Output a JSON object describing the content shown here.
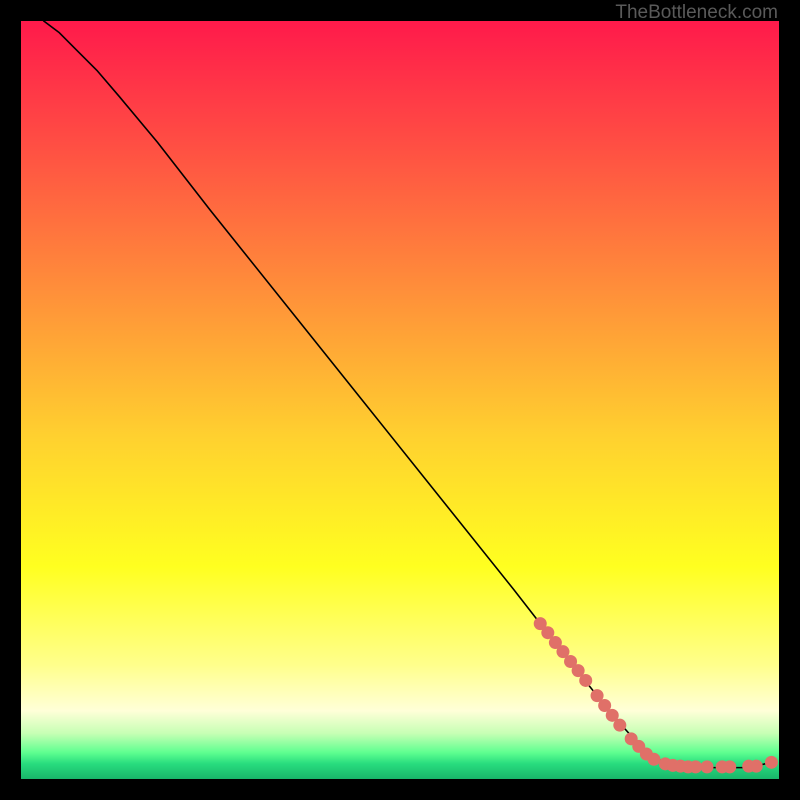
{
  "watermark": "TheBottleneck.com",
  "chart_data": {
    "type": "line",
    "title": "",
    "xlabel": "",
    "ylabel": "",
    "xlim": [
      0,
      100
    ],
    "ylim": [
      0,
      100
    ],
    "grid": false,
    "background_gradient": {
      "stops": [
        {
          "pct": 0,
          "color": "#ff1a4b"
        },
        {
          "pct": 15,
          "color": "#ff4a44"
        },
        {
          "pct": 35,
          "color": "#ff8d3a"
        },
        {
          "pct": 55,
          "color": "#ffd12f"
        },
        {
          "pct": 72,
          "color": "#ffff20"
        },
        {
          "pct": 85,
          "color": "#ffff8c"
        },
        {
          "pct": 91,
          "color": "#ffffd8"
        },
        {
          "pct": 94,
          "color": "#c6ffb4"
        },
        {
          "pct": 96.5,
          "color": "#5fff90"
        },
        {
          "pct": 98,
          "color": "#28dc7e"
        },
        {
          "pct": 100,
          "color": "#19b56a"
        }
      ]
    },
    "series": [
      {
        "name": "curve",
        "style": "line",
        "color": "#000000",
        "width": 1.6,
        "points_xy": [
          [
            3,
            100
          ],
          [
            5,
            98.5
          ],
          [
            7,
            96.5
          ],
          [
            10,
            93.5
          ],
          [
            13,
            90
          ],
          [
            18,
            84
          ],
          [
            25,
            75
          ],
          [
            35,
            62.5
          ],
          [
            45,
            50
          ],
          [
            55,
            37.5
          ],
          [
            65,
            25
          ],
          [
            72,
            16
          ],
          [
            78,
            8.5
          ],
          [
            82,
            4
          ],
          [
            85,
            2
          ],
          [
            88,
            1.5
          ],
          [
            92,
            1.5
          ],
          [
            96,
            1.5
          ],
          [
            99,
            2.2
          ]
        ]
      },
      {
        "name": "highlight-dots",
        "style": "dots",
        "color": "#e07068",
        "radius": 6.5,
        "points_xy": [
          [
            68.5,
            20.5
          ],
          [
            69.5,
            19.3
          ],
          [
            70.5,
            18.0
          ],
          [
            71.5,
            16.8
          ],
          [
            72.5,
            15.5
          ],
          [
            73.5,
            14.3
          ],
          [
            74.5,
            13.0
          ],
          [
            76.0,
            11.0
          ],
          [
            77.0,
            9.7
          ],
          [
            78.0,
            8.4
          ],
          [
            79.0,
            7.1
          ],
          [
            80.5,
            5.3
          ],
          [
            81.5,
            4.3
          ],
          [
            82.5,
            3.3
          ],
          [
            83.5,
            2.6
          ],
          [
            85.0,
            2.0
          ],
          [
            86.0,
            1.8
          ],
          [
            87.0,
            1.7
          ],
          [
            88.0,
            1.6
          ],
          [
            89.0,
            1.6
          ],
          [
            90.5,
            1.6
          ],
          [
            92.5,
            1.6
          ],
          [
            93.5,
            1.6
          ],
          [
            96.0,
            1.7
          ],
          [
            97.0,
            1.7
          ],
          [
            99.0,
            2.2
          ]
        ]
      }
    ]
  }
}
